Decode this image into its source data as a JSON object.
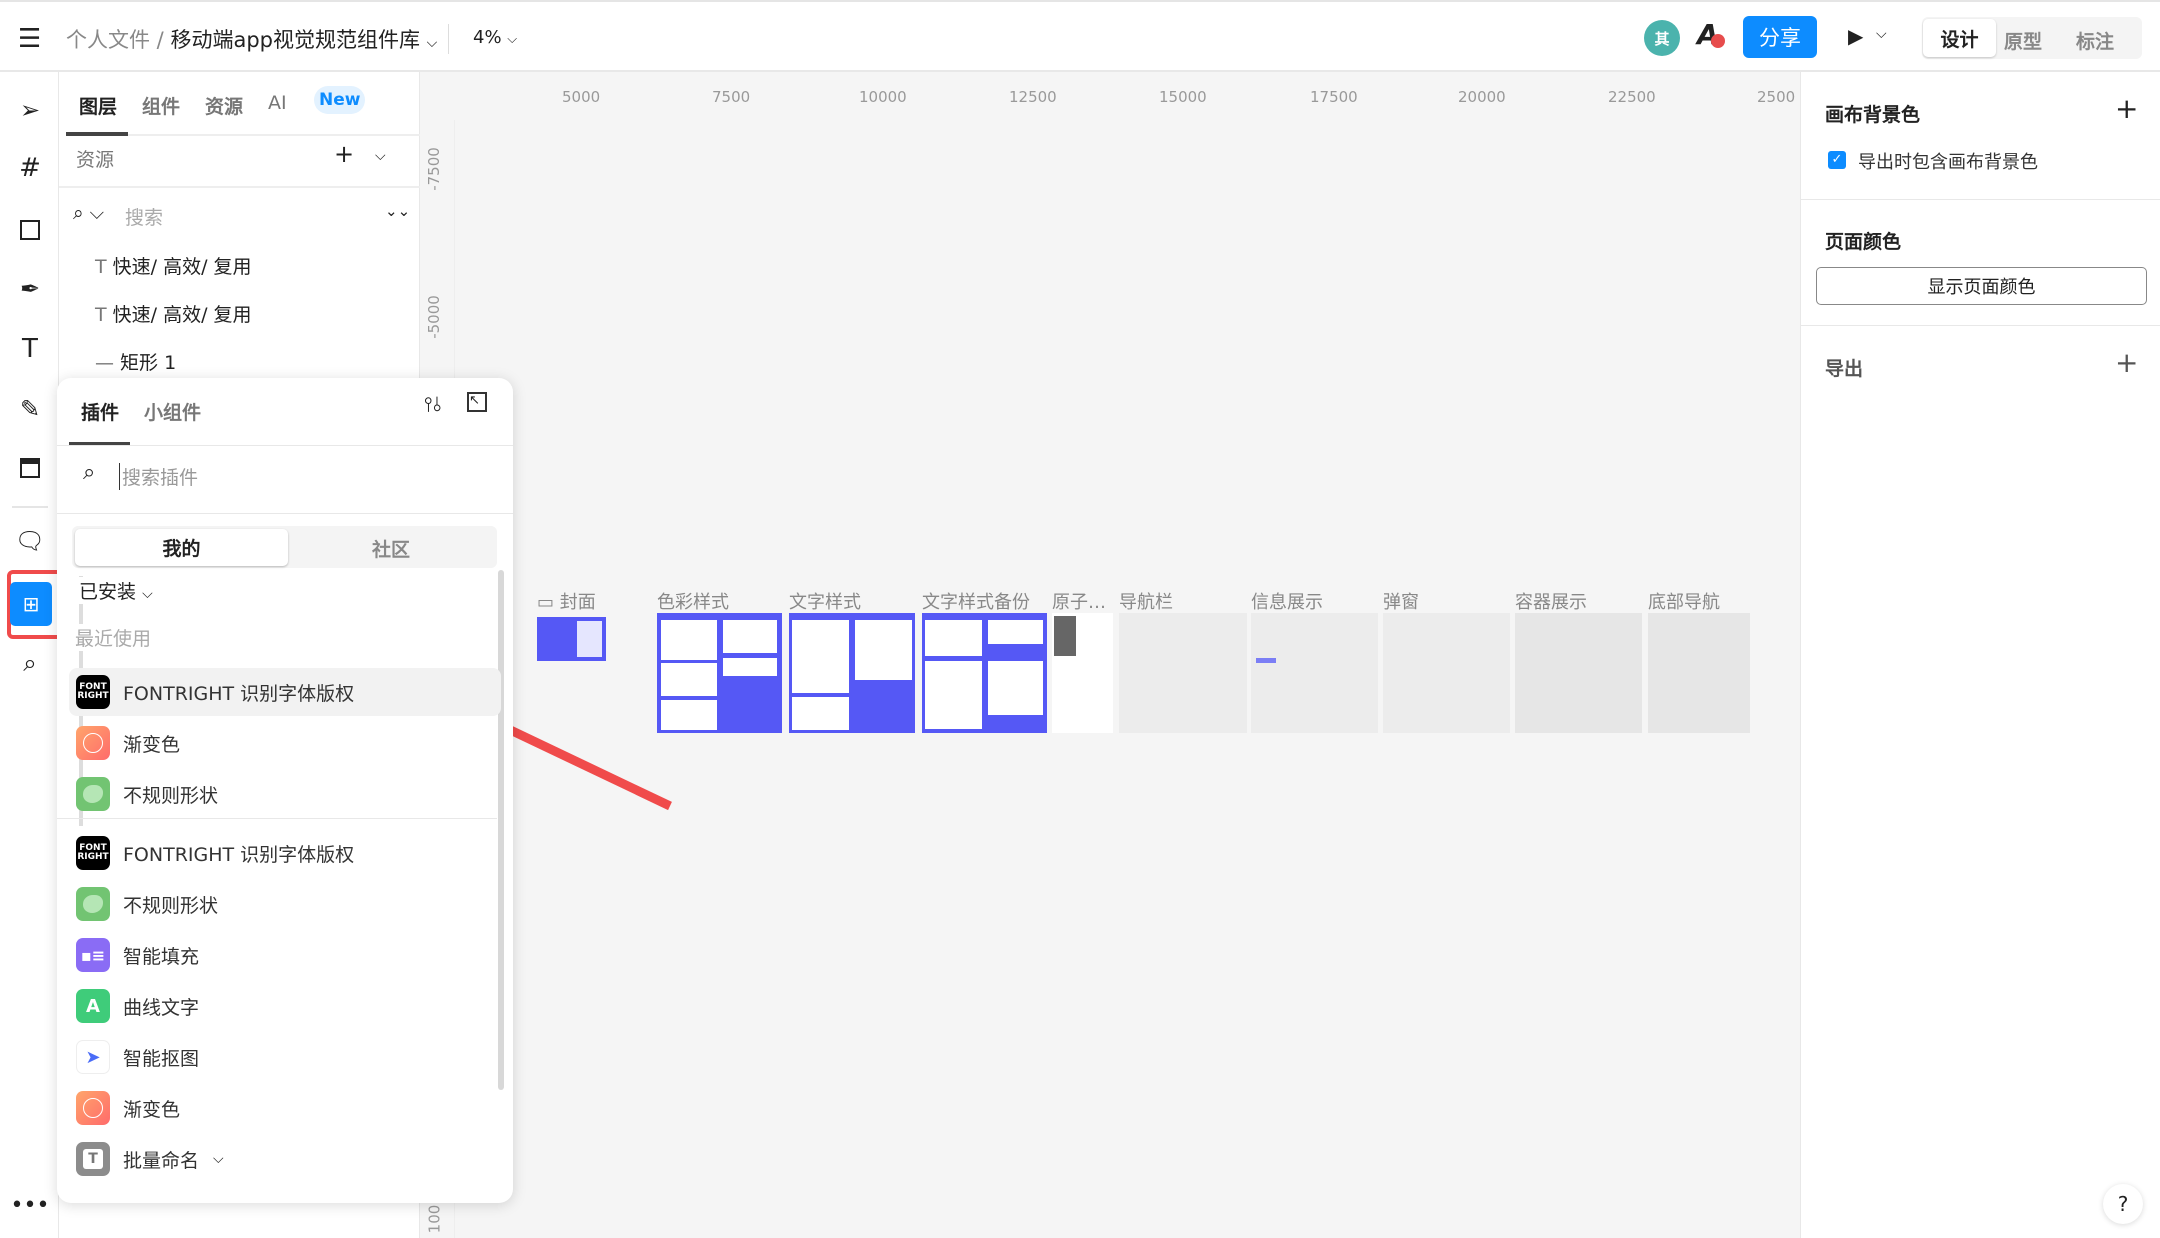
{
  "topbar": {
    "breadcrumb_parent": "个人文件 /",
    "file_name": "移动端app视觉规范组件库",
    "zoom": "4%",
    "avatar_initial": "其",
    "share": "分享",
    "modes": [
      "设计",
      "原型",
      "标注"
    ],
    "active_mode": "设计",
    "accent": "#0d8cff"
  },
  "layers_panel": {
    "tabs": [
      "图层",
      "组件",
      "资源",
      "AI"
    ],
    "new_badge": "New",
    "active_tab": "图层",
    "section": "资源",
    "search_placeholder": "搜索",
    "items": [
      {
        "icon": "text-icon",
        "label": "快速/ 高效/ 复用"
      },
      {
        "icon": "text-icon",
        "label": "快速/ 高效/ 复用"
      },
      {
        "icon": "line-icon",
        "label": "矩形 1"
      }
    ]
  },
  "ruler": {
    "x_ticks": [
      "5000",
      "7500",
      "10000",
      "12500",
      "15000",
      "17500",
      "20000",
      "22500",
      "2500"
    ],
    "y_ticks": [
      "-7500",
      "-5000",
      "100"
    ]
  },
  "plugins_panel": {
    "tabs": [
      "插件",
      "小组件"
    ],
    "active_tab": "插件",
    "search_placeholder": "搜索插件",
    "segments": [
      "我的",
      "社区"
    ],
    "active_segment": "我的",
    "installed": "已安装",
    "recent": "最近使用",
    "recent_items": [
      {
        "label": "FONTRIGHT 识别字体版权",
        "icon": "fontright-icon"
      },
      {
        "label": "渐变色",
        "icon": "gradient-icon"
      },
      {
        "label": "不规则形状",
        "icon": "blob-shape-icon"
      }
    ],
    "all_items": [
      {
        "label": "FONTRIGHT 识别字体版权",
        "icon": "fontright-icon"
      },
      {
        "label": "不规则形状",
        "icon": "blob-shape-icon"
      },
      {
        "label": "智能填充",
        "icon": "smart-fill-icon"
      },
      {
        "label": "曲线文字",
        "icon": "curve-text-icon"
      },
      {
        "label": "智能抠图",
        "icon": "cutout-icon"
      },
      {
        "label": "渐变色",
        "icon": "gradient-icon"
      },
      {
        "label": "批量命名",
        "icon": "batch-rename-icon"
      }
    ]
  },
  "canvas": {
    "frames": [
      "封面",
      "色彩样式",
      "文字样式",
      "文字样式备份",
      "原子…",
      "导航栏",
      "信息展示",
      "弹窗",
      "容器展示",
      "底部导航"
    ],
    "frame_color": "#5558f5",
    "highlight_color": "#f04b4b"
  },
  "right_panel": {
    "canvas_bg": "画布背景色",
    "export_with_bg": "导出时包含画布背景色",
    "export_with_bg_checked": true,
    "page_color": "页面颜色",
    "show_page_color": "显示页面颜色",
    "export": "导出"
  },
  "help": "?"
}
